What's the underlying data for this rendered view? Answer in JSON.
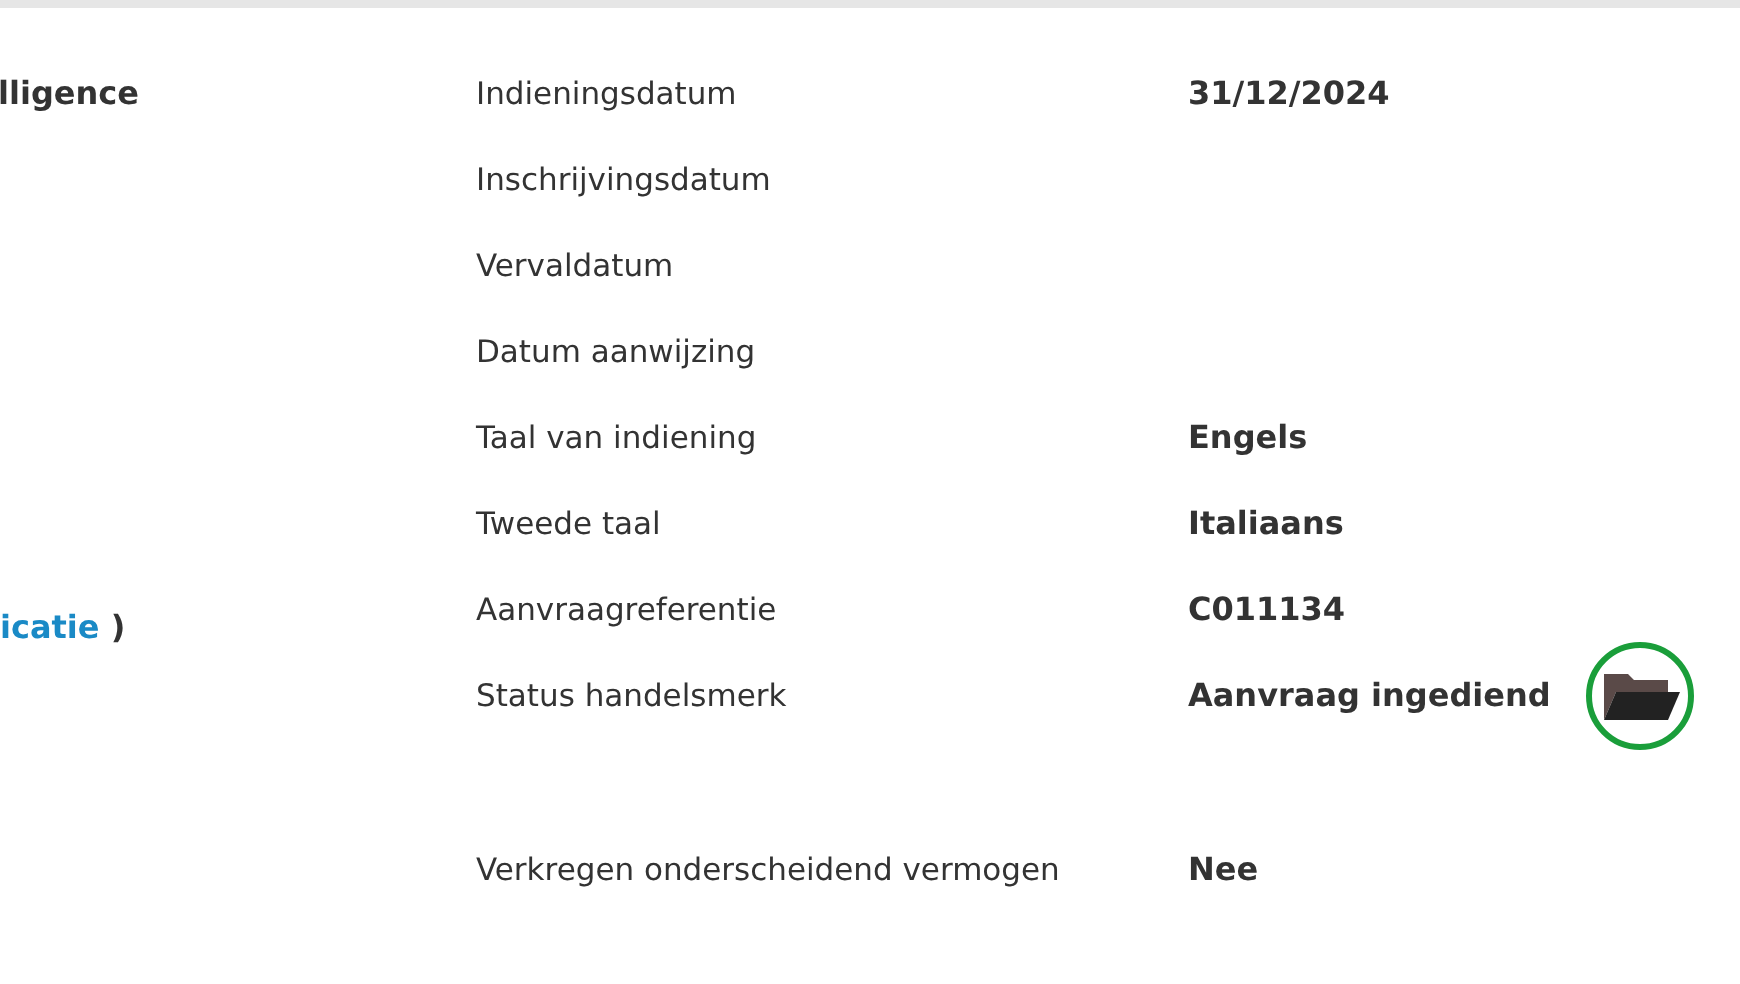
{
  "left_column": {
    "heading": "lligence",
    "link": {
      "text": "icatie",
      "suffix": ")"
    }
  },
  "details": [
    {
      "label": "Indieningsdatum",
      "value": "31/12/2024"
    },
    {
      "label": "Inschrijvingsdatum"
    },
    {
      "label": "Vervaldatum"
    },
    {
      "label": "Datum aanwijzing"
    },
    {
      "label": "Taal van indiening",
      "value": "Engels"
    },
    {
      "label": "Tweede taal",
      "value": "Italiaans"
    },
    {
      "label": "Aanvraagreferentie",
      "value": "C011134"
    },
    {
      "label": "Status handelsmerk",
      "value": "Aanvraag ingediend",
      "action": {
        "kind": "folder",
        "circled": true
      }
    },
    {
      "label": "Verkregen onderscheidend vermogen",
      "value": "Nee"
    }
  ]
}
